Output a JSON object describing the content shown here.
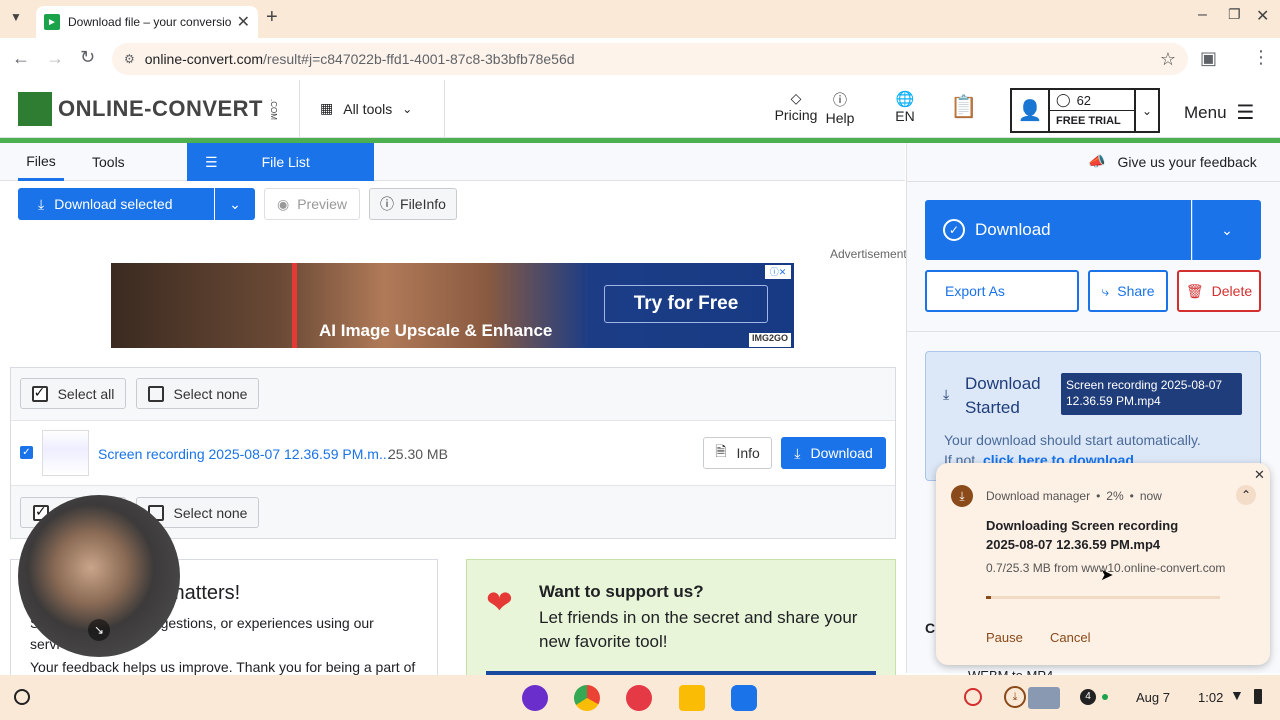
{
  "browser": {
    "tab_title": "Download file – your conversio",
    "url_host": "online-convert.com",
    "url_path": "/result#j=c847022b-ffd1-4001-87c8-3b3bfb78e56d"
  },
  "header": {
    "logo_text": "ONLINE-CONVERT",
    "logo_suffix": ".COM",
    "all_tools": "All tools",
    "pricing": "Pricing",
    "help": "Help",
    "lang": "EN",
    "credits": "62",
    "trial": "FREE TRIAL",
    "menu": "Menu"
  },
  "file_tabs": {
    "files": "Files",
    "tools": "Tools",
    "file_list": "File List"
  },
  "actions": {
    "download_selected": "Download selected",
    "preview": "Preview",
    "fileinfo": "FileInfo"
  },
  "ad": {
    "label": "Advertisement",
    "text": "AI Image Upscale & Enhance",
    "cta": "Try for Free",
    "brand": "IMG2GO"
  },
  "list": {
    "select_all": "Select all",
    "select_none": "Select none",
    "file_name": "Screen recording 2025-08-07 12.36.59 PM.m...",
    "file_size": "25.30 MB",
    "info": "Info",
    "download": "Download"
  },
  "feedback_card": {
    "title": "matters!",
    "line1": "suggestions, or experiences using our",
    "line1_prefix": "S",
    "line2": "servi",
    "line3": "Your feedback helps us improve. Thank you for being a part of"
  },
  "support_card": {
    "title": "Want to support us?",
    "text": "Let friends in on the secret and share your new favorite tool!"
  },
  "right": {
    "feedback": "Give us your feedback",
    "download": "Download",
    "export_as": "Export As",
    "share": "Share",
    "delete": "Delete",
    "started_title": "Download Started",
    "file_badge": "Screen recording 2025-08-07 12.36.59 PM.mp4",
    "auto_text": "Your download should start automatically.",
    "if_not": "If not,",
    "click_here": "click here to download",
    "cu": "Cu",
    "webm": "WEBM to MP4"
  },
  "notification": {
    "source": "Download manager",
    "percent": "2%",
    "time": "now",
    "title": "Downloading Screen recording 2025-08-07 12.36.59 PM.mp4",
    "progress_text": "0.7/25.3 MB from www10.online-convert.com",
    "progress": 0.02,
    "pause": "Pause",
    "cancel": "Cancel"
  },
  "taskbar": {
    "badge": "4",
    "date": "Aug 7",
    "time": "1:02"
  },
  "colors": {
    "accent": "#1a73e8",
    "brand_green": "#4caf50",
    "delete_red": "#d32f2f",
    "badge_navy": "#1f3d7a"
  }
}
